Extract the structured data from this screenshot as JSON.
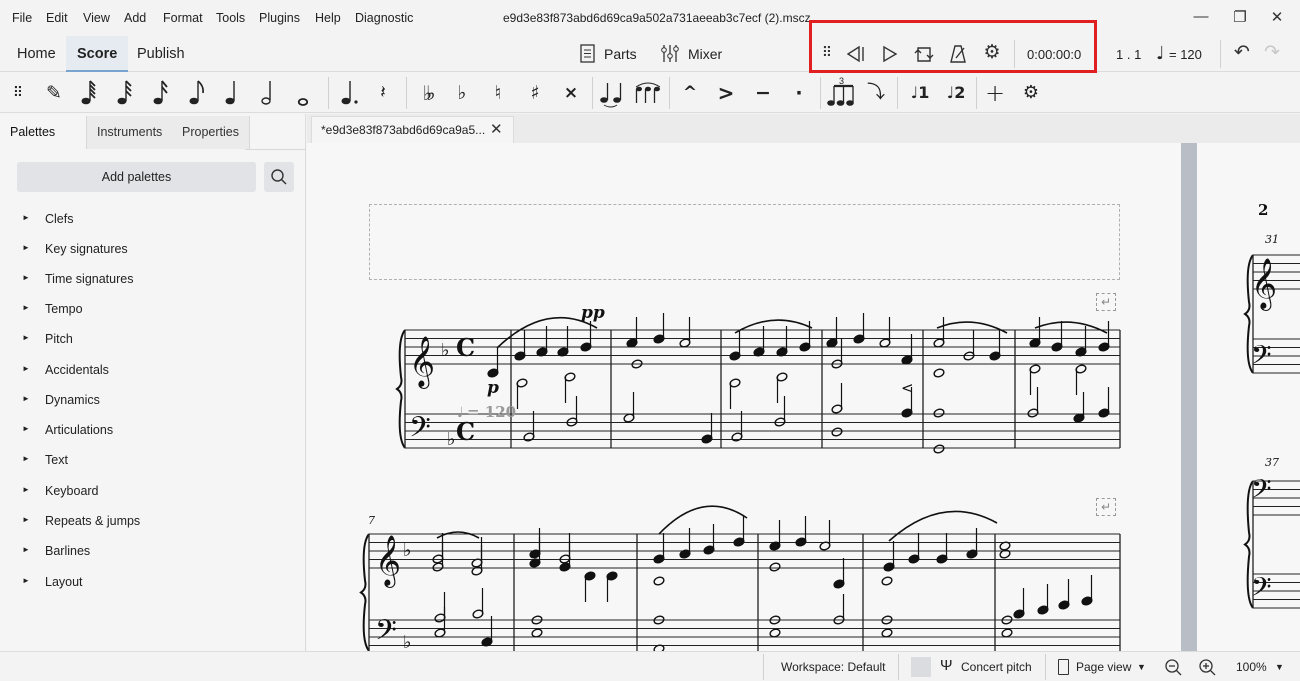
{
  "menubar": {
    "items": [
      "File",
      "Edit",
      "View",
      "Add",
      "Format",
      "Tools",
      "Plugins",
      "Help",
      "Diagnostic"
    ],
    "file_title": "e9d3e83f873abd6d69ca9a502a731aeeab3c7ecf (2).mscz",
    "window_controls": {
      "minimize": "—",
      "restore": "❐",
      "close": "✕"
    }
  },
  "top_tabs": [
    {
      "label": "Home",
      "active": false
    },
    {
      "label": "Score",
      "active": true
    },
    {
      "label": "Publish",
      "active": false
    }
  ],
  "toolbar": {
    "parts_label": "Parts",
    "mixer_label": "Mixer",
    "playback": {
      "icons": [
        "drag-handle-icon",
        "rewind-icon",
        "play-icon",
        "loop-icon",
        "metronome-icon",
        "settings-icon"
      ],
      "time": "0:00:00:0"
    },
    "position": "1 . 1",
    "tempo": "= 120",
    "highlight_color": "#e02020"
  },
  "note_input": {
    "items": [
      {
        "name": "drag-handle-icon",
        "glyph": "⠿"
      },
      {
        "name": "pencil-icon",
        "glyph": "✎"
      },
      {
        "name": "64th-note-icon",
        "glyph": "𝅘𝅥𝅱"
      },
      {
        "name": "32nd-note-icon",
        "glyph": "𝅘𝅥𝅰"
      },
      {
        "name": "16th-note-icon",
        "glyph": "𝅘𝅥𝅯"
      },
      {
        "name": "eighth-note-icon",
        "glyph": "♪"
      },
      {
        "name": "quarter-note-icon",
        "glyph": "♩"
      },
      {
        "name": "half-note-icon",
        "glyph": "𝅗𝅥"
      },
      {
        "name": "whole-note-icon",
        "glyph": "o"
      },
      {
        "name": "dotted-note-icon",
        "glyph": "♩."
      },
      {
        "name": "rest-icon",
        "glyph": "𝄽"
      },
      {
        "name": "double-flat-icon",
        "glyph": "♭♭"
      },
      {
        "name": "flat-icon",
        "glyph": "♭"
      },
      {
        "name": "natural-icon",
        "glyph": "♮"
      },
      {
        "name": "sharp-icon",
        "glyph": "♯"
      },
      {
        "name": "double-sharp-icon",
        "glyph": "×"
      },
      {
        "name": "tie-icon",
        "glyph": "♩‿♩"
      },
      {
        "name": "slur-icon",
        "glyph": "⌒"
      },
      {
        "name": "marcato-icon",
        "glyph": "^"
      },
      {
        "name": "accent-icon",
        "glyph": ">"
      },
      {
        "name": "tenuto-icon",
        "glyph": "−"
      },
      {
        "name": "staccato-icon",
        "glyph": "·"
      },
      {
        "name": "tuplet-icon",
        "glyph": "♫"
      },
      {
        "name": "flip-direction-icon",
        "glyph": "↷"
      },
      {
        "name": "voice-1-icon",
        "glyph": "♩1"
      },
      {
        "name": "voice-2-icon",
        "glyph": "♩2"
      },
      {
        "name": "add-icon",
        "glyph": "+"
      },
      {
        "name": "customize-icon",
        "glyph": "⚙"
      }
    ]
  },
  "left_panel": {
    "tabs": [
      {
        "label": "Palettes",
        "active": true,
        "menu": "···"
      },
      {
        "label": "Instruments",
        "active": false
      },
      {
        "label": "Properties",
        "active": false
      }
    ],
    "add_palettes_label": "Add palettes",
    "palettes": [
      "Clefs",
      "Key signatures",
      "Time signatures",
      "Tempo",
      "Pitch",
      "Accidentals",
      "Dynamics",
      "Articulations",
      "Text",
      "Keyboard",
      "Repeats & jumps",
      "Barlines",
      "Layout"
    ]
  },
  "document_tab": {
    "label": "*e9d3e83f873abd6d69ca9a5...",
    "close": "✕"
  },
  "score": {
    "tempo_marking": "= 120",
    "dynamics": [
      "p",
      "pp"
    ],
    "hairpin": "<",
    "measure_number_system2": "7",
    "page2_number": "2",
    "page2_measure_numbers": [
      "31",
      "37"
    ],
    "key_signature": "F major (1 flat)",
    "time_signature": "C"
  },
  "statusbar": {
    "workspace": "Workspace: Default",
    "concert_pitch": "Concert pitch",
    "view_mode": "Page view",
    "zoom": "100%"
  }
}
